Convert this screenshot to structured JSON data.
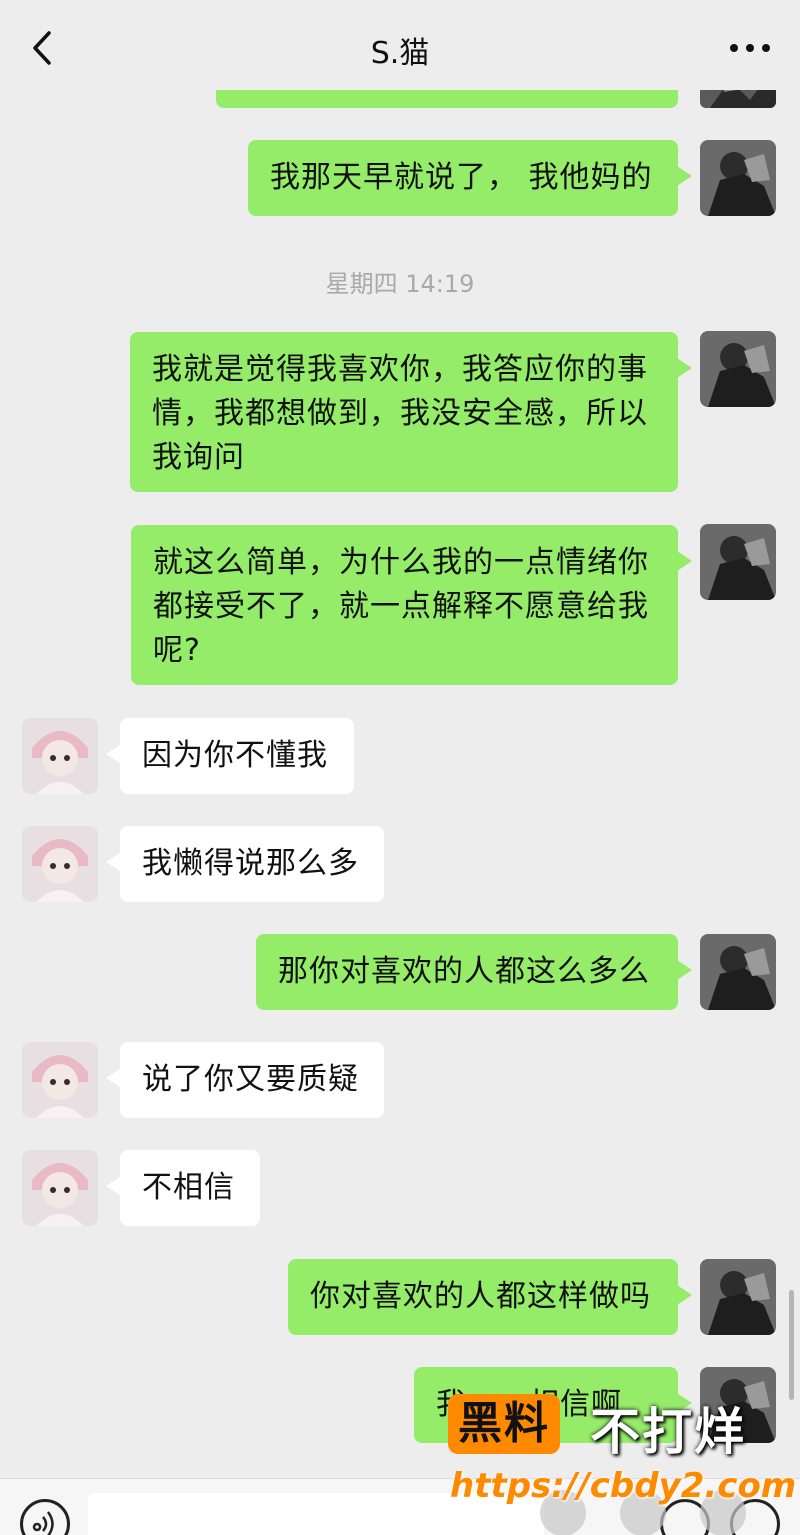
{
  "header": {
    "title": "S.猫"
  },
  "timestamp": "星期四 14:19",
  "messages": [
    {
      "from": "me",
      "text": "我那天早就说了， 我他妈的"
    },
    {
      "from": "me",
      "text": "我就是觉得我喜欢你，我答应你的事情，我都想做到，我没安全感，所以我询问"
    },
    {
      "from": "me",
      "text": "就这么简单，为什么我的一点情绪你都接受不了，就一点解释不愿意给我呢?"
    },
    {
      "from": "them",
      "text": "因为你不懂我"
    },
    {
      "from": "them",
      "text": "我懒得说那么多"
    },
    {
      "from": "me",
      "text": "那你对喜欢的人都这么多么"
    },
    {
      "from": "them",
      "text": "说了你又要质疑"
    },
    {
      "from": "them",
      "text": "不相信"
    },
    {
      "from": "me",
      "text": "你对喜欢的人都这样做吗"
    },
    {
      "from": "me",
      "text": "我……相信啊"
    }
  ],
  "watermark": {
    "logo": "黑料",
    "slogan": "不打烊",
    "url": "https://cbdy2.com"
  },
  "colors": {
    "background": "#ededed",
    "my_bubble": "#95ec69",
    "their_bubble": "#ffffff",
    "watermark_accent": "#ff8a00"
  },
  "icons": {
    "back": "chevron-left-icon",
    "more": "ellipsis-icon",
    "voice": "voice-icon",
    "emoji": "emoji-icon",
    "plus": "plus-icon"
  }
}
